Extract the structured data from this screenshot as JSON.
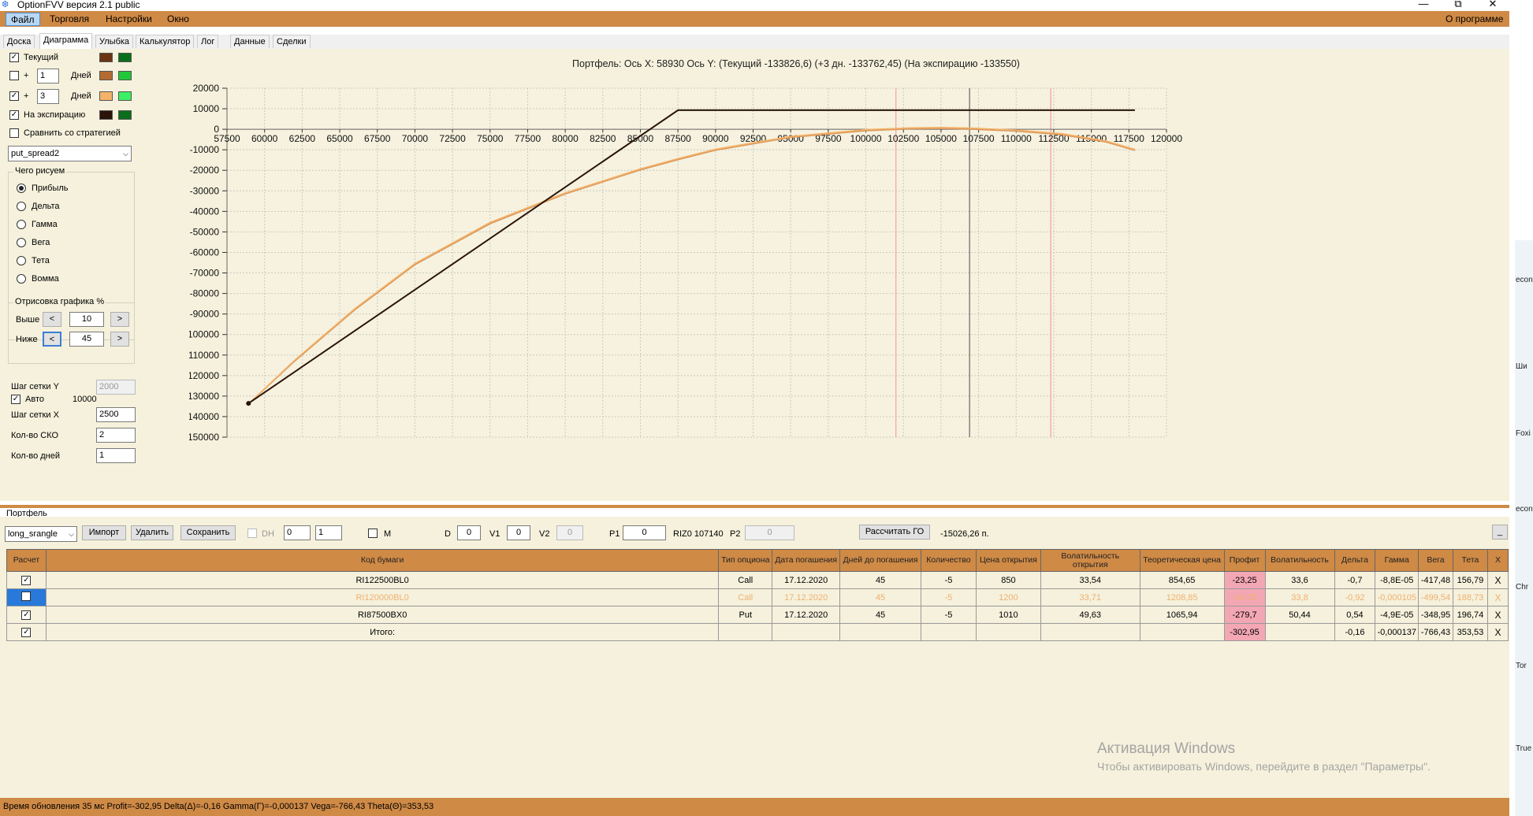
{
  "window": {
    "title": "OptionFVV версия 2.1 public",
    "minimize": "—",
    "maximize": "⧉",
    "close": "✕"
  },
  "menu": {
    "items": [
      "Файл",
      "Торговля",
      "Настройки",
      "Окно"
    ],
    "about": "О программе"
  },
  "tabs": [
    "Доска",
    "Диаграмма",
    "Улыбка",
    "Калькулятор",
    "Лог",
    "Данные",
    "Сделки"
  ],
  "left_panel": {
    "curves": [
      {
        "checked": true,
        "label": "Текущий",
        "color1": "#6b3413",
        "color2": "#0b6e1a"
      },
      {
        "checked": false,
        "label": "+",
        "days": "1",
        "days_label": "Дней",
        "color1": "#b46b32",
        "color2": "#20c838"
      },
      {
        "checked": true,
        "label": "+",
        "days": "3",
        "days_label": "Дней",
        "color1": "#f4b36a",
        "color2": "#3af064"
      },
      {
        "checked": true,
        "label": "На экспирацию",
        "color1": "#2a140a",
        "color2": "#0b6e1a"
      }
    ],
    "compare": {
      "checked": false,
      "label": "Сравнить со стратегией"
    },
    "strategy": "put_spread2",
    "what_title": "Чего рисуем",
    "what_options": [
      "Прибыль",
      "Дельта",
      "Гамма",
      "Вега",
      "Тета",
      "Вомма"
    ],
    "what_selected": 0,
    "draw_title": "Отрисовка графика %",
    "above_label": "Выше",
    "above_value": "10",
    "below_label": "Ниже",
    "below_value": "45",
    "arrow_left": "<",
    "arrow_right": ">",
    "grid_y_label": "Шаг сетки Y",
    "grid_y_value": "2000",
    "auto_label": "Авто",
    "auto_checked": true,
    "auto_value": "10000",
    "grid_x_label": "Шаг сетки X",
    "grid_x_value": "2500",
    "sko_label": "Кол-во СКО",
    "sko_value": "2",
    "days_label": "Кол-во дней",
    "days_value": "1"
  },
  "chart_data": {
    "type": "line",
    "title": "Портфель: Ось X: 58930 Ось Y:  (Текущий -133826,6)  (+3 дн. -133762,45)  (На экспирацию -133550)",
    "xlabel": "",
    "ylabel": "",
    "xlim": [
      57500,
      120000
    ],
    "ylim": [
      -150000,
      20000
    ],
    "x_ticks": [
      57500,
      60000,
      62500,
      65000,
      67500,
      70000,
      72500,
      75000,
      77500,
      80000,
      82500,
      85000,
      87500,
      90000,
      92500,
      95000,
      97500,
      100000,
      102500,
      105000,
      107500,
      110000,
      112500,
      115000,
      117500,
      120000
    ],
    "y_ticks": [
      20000,
      10000,
      0,
      -10000,
      -20000,
      -30000,
      -40000,
      -50000,
      -60000,
      -70000,
      -80000,
      -90000,
      -100000,
      -110000,
      -120000,
      -130000,
      -140000,
      -150000
    ],
    "vlines": [
      {
        "x": 102000,
        "color": "#f4a0a0"
      },
      {
        "x": 106900,
        "color": "#666666"
      },
      {
        "x": 112300,
        "color": "#f4a0a0"
      }
    ],
    "series": [
      {
        "color": "#d9965a",
        "x": [
          58930,
          62000,
          66000,
          70000,
          75000,
          80000,
          85000,
          87500,
          90000,
          95000,
          100000,
          103000,
          105000,
          107000,
          110000,
          113000,
          116000,
          117900
        ],
        "y": [
          -133826.6,
          -113000,
          -88000,
          -66000,
          -46000,
          -31500,
          -19800,
          -14800,
          -10200,
          -4000,
          -700,
          200,
          400,
          100,
          -900,
          -2600,
          -6200,
          -10300
        ]
      },
      {
        "color": "#f4b36a",
        "x": [
          58930,
          62000,
          66000,
          70000,
          75000,
          80000,
          85000,
          87500,
          90000,
          95000,
          100000,
          103000,
          105000,
          107000,
          110000,
          113000,
          116000,
          117900
        ],
        "y": [
          -133762.45,
          -112500,
          -87400,
          -65400,
          -45400,
          -31000,
          -19300,
          -14300,
          -9700,
          -3500,
          -200,
          700,
          900,
          600,
          -400,
          -2100,
          -5700,
          -9800
        ]
      },
      {
        "color": "#2a140a",
        "x": [
          58930,
          87500,
          117900
        ],
        "y": [
          -133550,
          9300,
          9300
        ]
      }
    ]
  },
  "portfolio": {
    "section_label": "Портфель",
    "name": "long_srangle",
    "import": "Импорт",
    "delete": "Удалить",
    "save": "Сохранить",
    "dh_label": "DH",
    "spin1": "0",
    "spin2": "1",
    "m_label": "M",
    "d_label": "D",
    "d_value": "0",
    "v1_label": "V1",
    "v1_value": "0",
    "v2_label": "V2",
    "v2_value": "0",
    "p1_label": "P1",
    "p1_value": "0",
    "riz_text": "RIZ0 107140",
    "p2_label": "P2",
    "p2_value": "0",
    "go_button": "Рассчитать ГО",
    "go_value": "-15026,26 п.",
    "collapse": "_"
  },
  "table": {
    "columns": [
      "Расчет",
      "Код бумаги",
      "Тип опциона",
      "Дата погашения",
      "Дней до погашения",
      "Количество",
      "Цена открытия",
      "Волатильность открытия",
      "Теоретическая цена",
      "Профит",
      "Волатильность",
      "Дельта",
      "Гамма",
      "Вега",
      "Тета",
      "X"
    ],
    "rows": [
      {
        "checked": true,
        "faded": false,
        "cells": [
          "RI122500BL0",
          "Call",
          "17.12.2020",
          "45",
          "-5",
          "850",
          "33,54",
          "854,65",
          "-23,25",
          "33,6",
          "-0,7",
          "-8,8E-05",
          "-417,48",
          "156,79"
        ]
      },
      {
        "checked": false,
        "faded": true,
        "cells": [
          "RI120000BL0",
          "Call",
          "17.12.2020",
          "45",
          "-5",
          "1200",
          "33,71",
          "1208,85",
          "-44,25",
          "33,8",
          "-0,92",
          "-0,000105",
          "-499,54",
          "188,73"
        ]
      },
      {
        "checked": true,
        "faded": false,
        "cells": [
          "RI87500BX0",
          "Put",
          "17.12.2020",
          "45",
          "-5",
          "1010",
          "49,63",
          "1065,94",
          "-279,7",
          "50,44",
          "0,54",
          "-4,9E-05",
          "-348,95",
          "196,74"
        ]
      },
      {
        "checked": true,
        "faded": false,
        "cells": [
          "Итого:",
          "",
          "",
          "",
          "",
          "",
          "",
          "",
          "-302,95",
          "",
          "-0,16",
          "-0,000137",
          "-766,43",
          "353,53"
        ]
      }
    ],
    "delete_glyph": "X"
  },
  "status": "Время обновления 35 мс  Profit=-302,95 Delta(Δ)=-0,16 Gamma(Γ)=-0,000137 Vega=-766,43 Theta(Θ)=353,53",
  "watermark": {
    "line1": "Активация Windows",
    "line2": "Чтобы активировать Windows, перейдите в раздел \"Параметры\"."
  },
  "desktop_icons": [
    "econ",
    "Ши",
    "Foxi",
    "econ",
    "Chr",
    "Tor",
    "True"
  ]
}
